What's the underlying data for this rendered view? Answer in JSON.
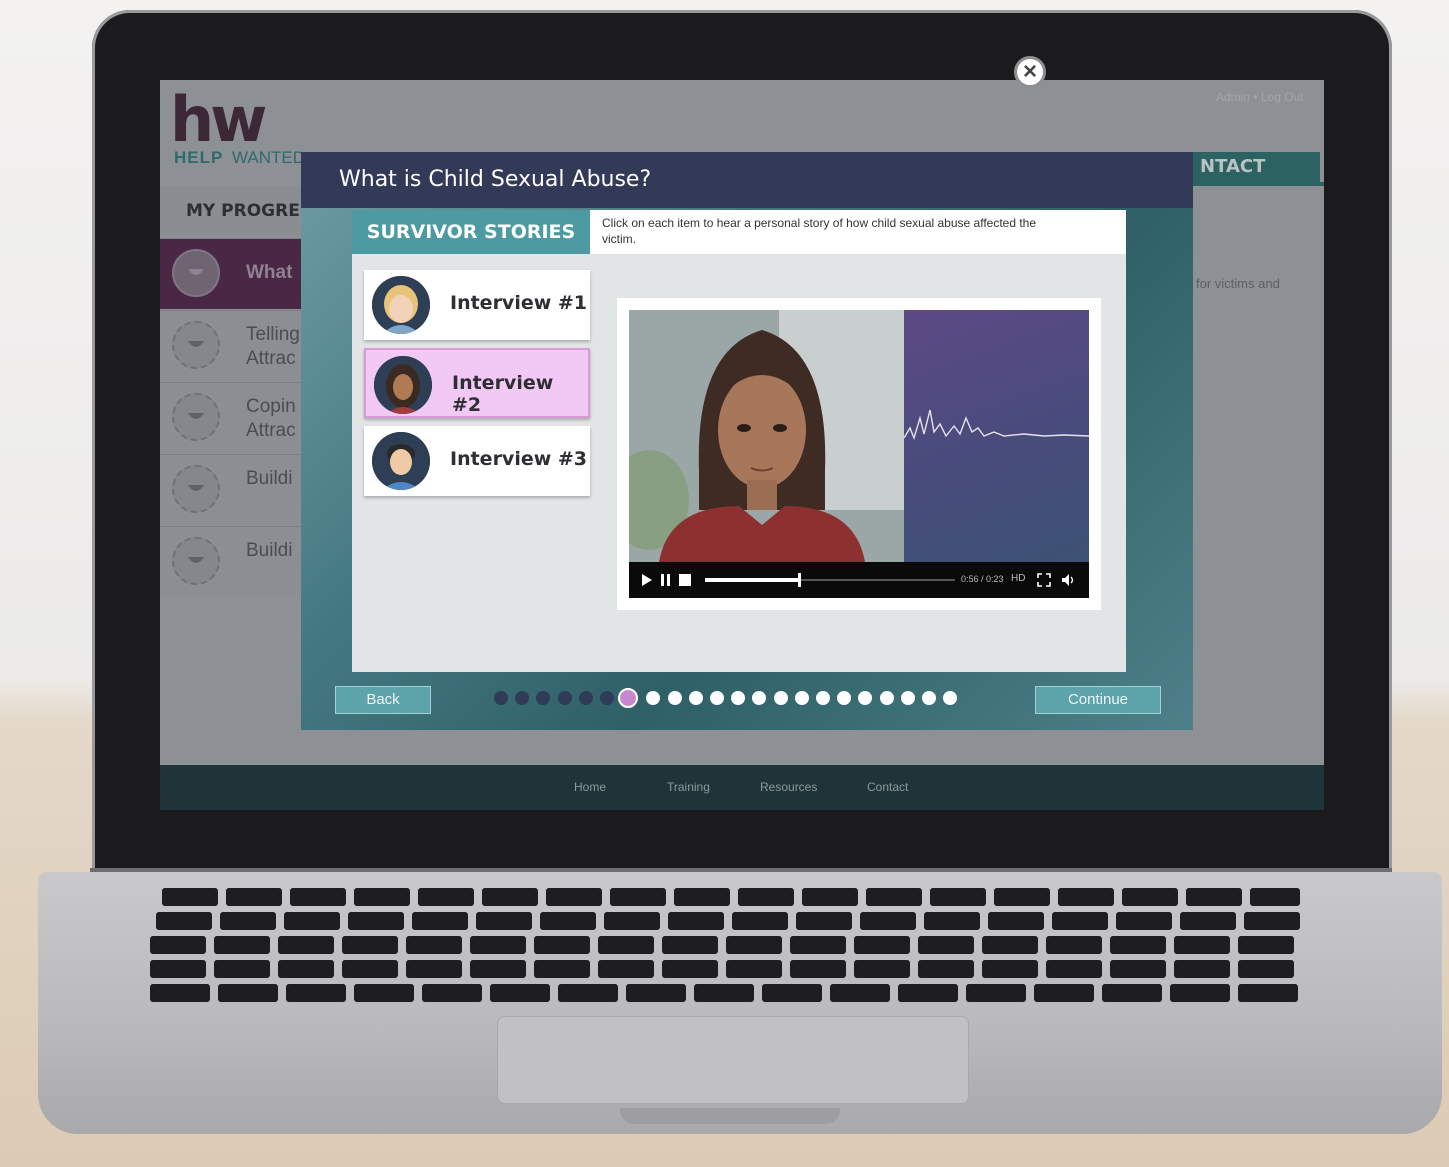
{
  "site": {
    "logo_mark": "hw",
    "logo_help": "HELP",
    "logo_wanted": "WANTED",
    "top_nav": "Admin • Log Out",
    "contact_tab": "NTACT",
    "side_text": "for victims and",
    "progress_heading": "MY PROGRESS",
    "progress_items": [
      {
        "label": "What",
        "active": true
      },
      {
        "label": "Telling\nAttrac",
        "active": false
      },
      {
        "label": "Copin\nAttrac",
        "active": false
      },
      {
        "label": "Buildi",
        "active": false
      },
      {
        "label": "Buildi",
        "active": false
      }
    ],
    "footer_links": [
      "Home",
      "Training",
      "Resources",
      "Contact"
    ]
  },
  "modal": {
    "title": "What is Child Sexual Abuse?",
    "close_icon": "close-icon",
    "section_tab": "SURVIVOR STORIES",
    "instructions": "Click on each item to hear a personal story of how child sexual abuse affected the victim.",
    "interviews": [
      {
        "label": "Interview #1",
        "selected": false
      },
      {
        "label": "Interview #2",
        "selected": true
      },
      {
        "label": "Interview #3",
        "selected": false
      }
    ],
    "video": {
      "time": "0:56 / 0:23",
      "hd_label": "HD",
      "progress_fraction": 0.37
    },
    "back_label": "Back",
    "continue_label": "Continue",
    "step_total": 22,
    "step_current": 7
  },
  "colors": {
    "header": "#333a57",
    "accent_teal": "#4d9aa2",
    "selected_pink": "#f2c8f4",
    "active_purple": "#4a2744"
  }
}
